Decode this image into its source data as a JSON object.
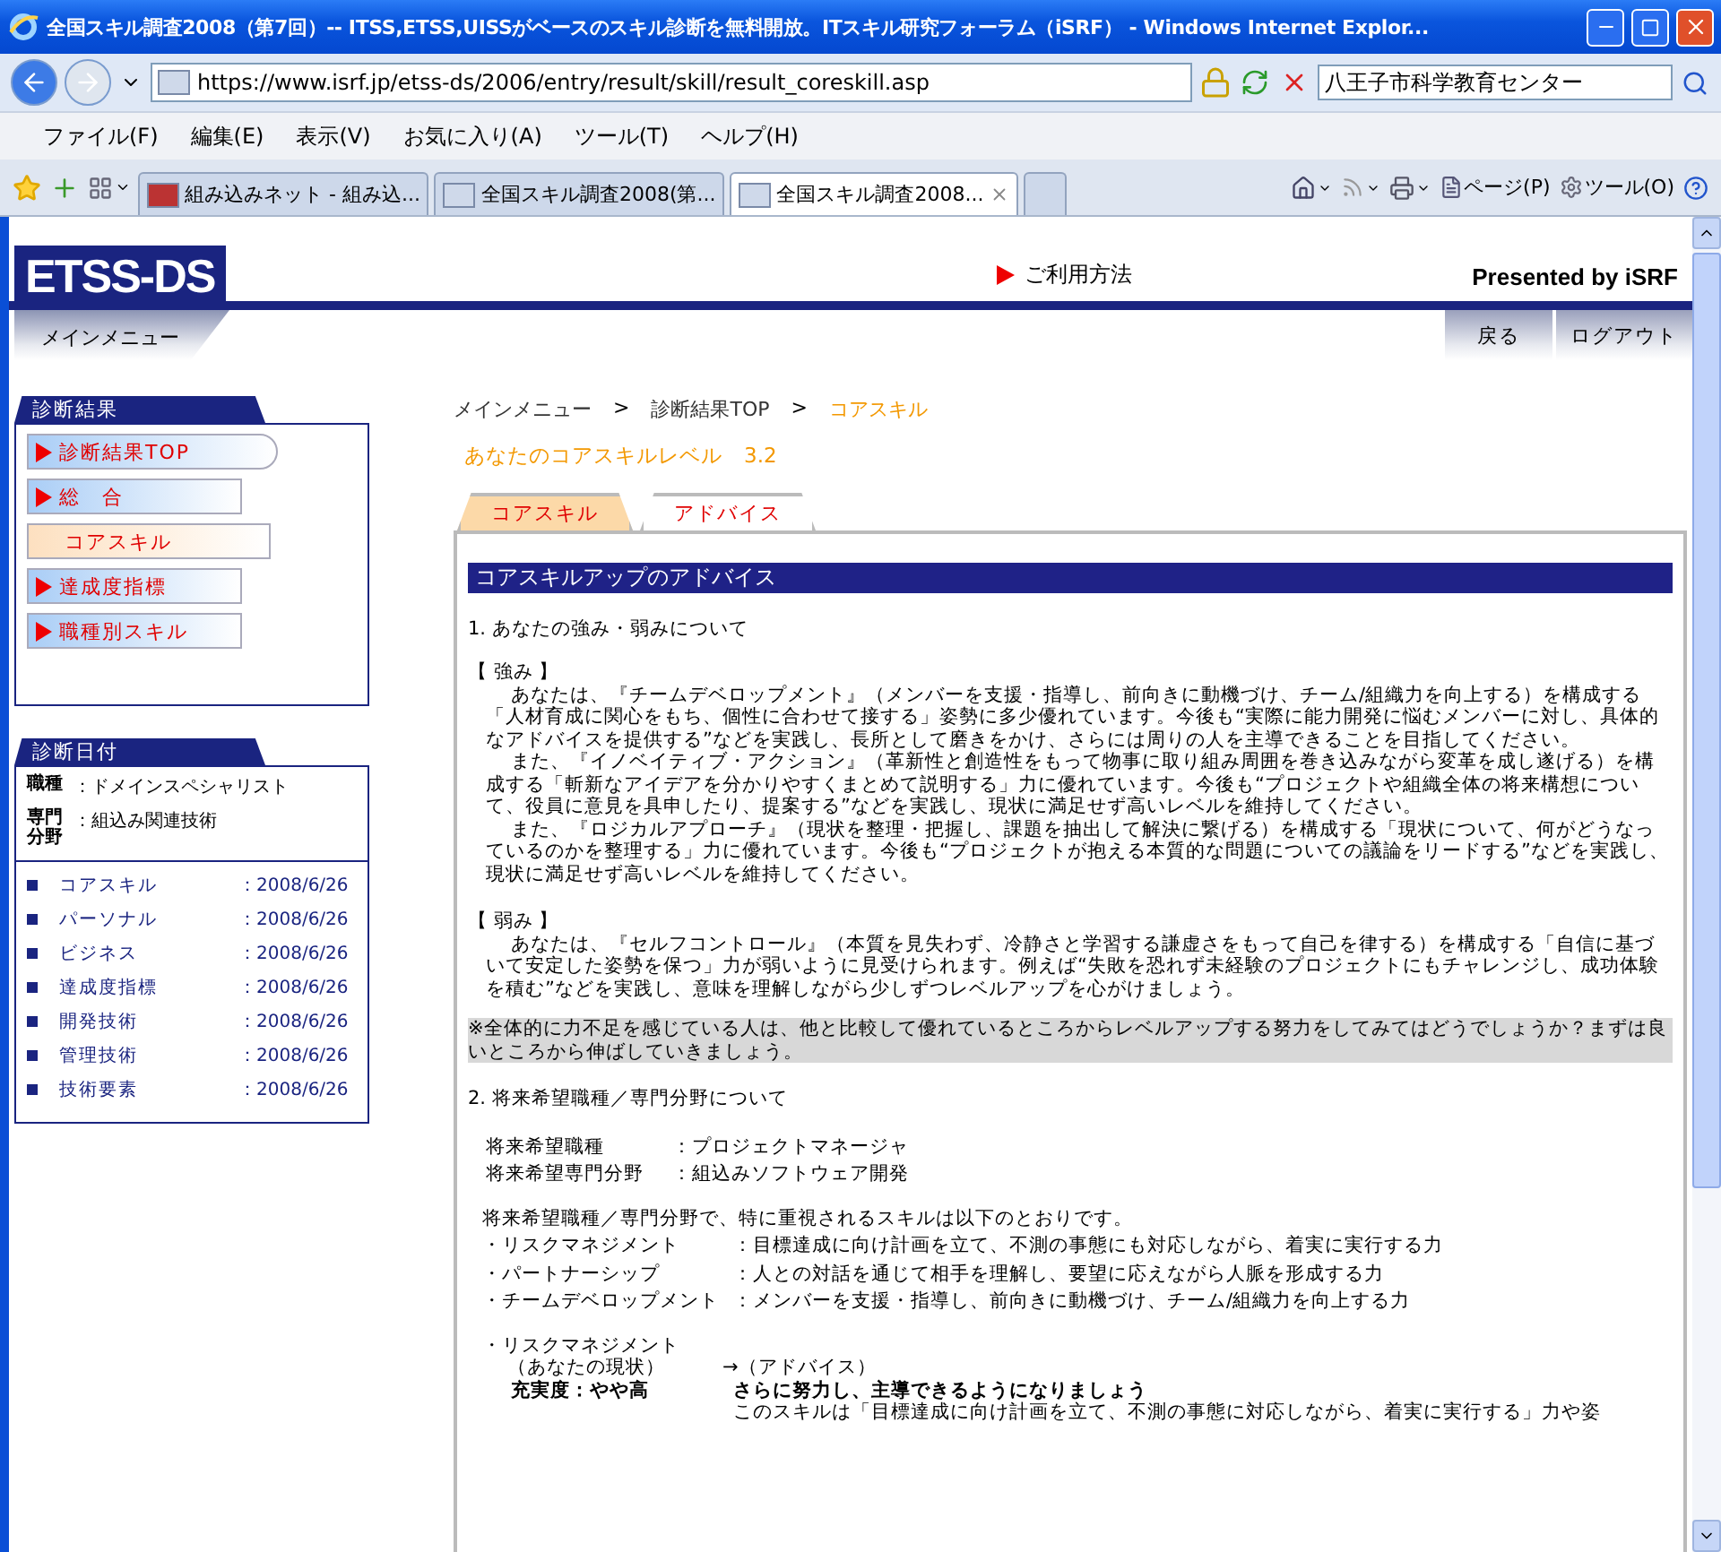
{
  "window": {
    "title": "全国スキル調査2008（第7回）-- ITSS,ETSS,UISSがベースのスキル診断を無料開放。ITスキル研究フォーラム（iSRF） - Windows Internet Explor..."
  },
  "address_bar": {
    "url": "https://www.isrf.jp/etss-ds/2006/entry/result/skill/result_coreskill.asp",
    "search_value": "八王子市科学教育センター"
  },
  "menu_bar": [
    "ファイル(F)",
    "編集(E)",
    "表示(V)",
    "お気に入り(A)",
    "ツール(T)",
    "ヘルプ(H)"
  ],
  "browser_tabs": [
    {
      "label": "組み込みネット - 組み込...",
      "selected": false,
      "kind": "site"
    },
    {
      "label": "全国スキル調査2008(第...",
      "selected": false,
      "kind": "isrf"
    },
    {
      "label": "全国スキル調査2008...",
      "selected": true,
      "kind": "isrf"
    }
  ],
  "command_bar": {
    "page": "ページ(P)",
    "tools": "ツール(O)"
  },
  "page": {
    "logo": "ETSS-DS",
    "usage_link": "ご利用方法",
    "presented_by": "Presented by iSRF",
    "main_menu": "メインメニュー",
    "nav_buttons": [
      "戻る",
      "ログアウト"
    ],
    "sidebar": {
      "results": {
        "title": "診断結果",
        "items": [
          {
            "label": "診断結果TOP",
            "selected": false,
            "kind": "round"
          },
          {
            "label": "総　合",
            "selected": false,
            "kind": "square"
          },
          {
            "label": "コアスキル",
            "selected": true,
            "kind": "square"
          },
          {
            "label": "達成度指標",
            "selected": false,
            "kind": "square"
          },
          {
            "label": "職種別スキル",
            "selected": false,
            "kind": "square"
          }
        ]
      },
      "dates": {
        "title": "診断日付",
        "profile": [
          {
            "label": "職種",
            "value": "：ドメインスペシャリスト"
          },
          {
            "label": "専門分野",
            "value": "：組込み関連技術"
          }
        ],
        "rows": [
          {
            "name": "コアスキル",
            "date": "：2008/6/26"
          },
          {
            "name": "パーソナル",
            "date": "：2008/6/26"
          },
          {
            "name": "ビジネス",
            "date": "：2008/6/26"
          },
          {
            "name": "達成度指標",
            "date": "：2008/6/26"
          },
          {
            "name": "開発技術",
            "date": "：2008/6/26"
          },
          {
            "name": "管理技術",
            "date": "：2008/6/26"
          },
          {
            "name": "技術要素",
            "date": "：2008/6/26"
          }
        ]
      }
    },
    "breadcrumb": [
      {
        "label": "メインメニュー",
        "kind": "link"
      },
      {
        "label": ">",
        "kind": "separator"
      },
      {
        "label": "診断結果TOP",
        "kind": "link"
      },
      {
        "label": ">",
        "kind": "separator"
      },
      {
        "label": "コアスキル",
        "kind": "current"
      }
    ],
    "level_text": "あなたのコアスキルレベル　3.2",
    "content_tabs": [
      {
        "label": "コアスキル",
        "selected": true
      },
      {
        "label": "アドバイス",
        "selected": false
      }
    ],
    "advice": {
      "heading": "コアスキルアップのアドバイス",
      "section_1": "1. あなたの強み・弱みについて",
      "strengths": {
        "title": "【 強み 】",
        "paragraphs": [
          "あなたは、『チームデベロップメント』（メンバーを支援・指導し、前向きに動機づけ、チーム/組織力を向上する）を構成する「人材育成に関心をもち、個性に合わせて接する」姿勢に多少優れています。今後も“実際に能力開発に悩むメンバーに対し、具体的なアドバイスを提供する”などを実践し、長所として磨きをかけ、さらには周りの人を主導できることを目指してください。",
          "また、『イノベイティブ・アクション』（革新性と創造性をもって物事に取り組み周囲を巻き込みながら変革を成し遂げる）を構成する「斬新なアイデアを分かりやすくまとめて説明する」力に優れています。今後も“プロジェクトや組織全体の将来構想について、役員に意見を具申したり、提案する”などを実践し、現状に満足せず高いレベルを維持してください。",
          "また、『ロジカルアプローチ』（現状を整理・把握し、課題を抽出して解決に繋げる）を構成する「現状について、何がどうなっているのかを整理する」力に優れています。今後も“プロジェクトが抱える本質的な問題についての議論をリードする”などを実践し、現状に満足せず高いレベルを維持してください。"
        ]
      },
      "weaknesses": {
        "title": "【 弱み 】",
        "paragraphs": [
          "あなたは、『セルフコントロール』（本質を見失わず、冷静さと学習する謙虚さをもって自己を律する）を構成する「自信に基づいて安定した姿勢を保つ」力が弱いように見受けられます。例えば“失敗を恐れず未経験のプロジェクトにもチャレンジし、成功体験を積む”などを実践し、意味を理解しながら少しずつレベルアップを心がけましょう。"
        ]
      },
      "note": "※全体的に力不足を感じている人は、他と比較して優れているところからレベルアップする努力をしてみてはどうでしょうか？まずは良いところから伸ばしていきましょう。",
      "section_2": "2. 将来希望職種／専門分野について",
      "desired": [
        {
          "label": "将来希望職種",
          "value": "：プロジェクトマネージャ"
        },
        {
          "label": "将来希望専門分野",
          "value": "：組込みソフトウェア開発"
        }
      ],
      "skills_intro": "将来希望職種／専門分野で、特に重視されるスキルは以下のとおりです。",
      "skills": [
        {
          "name": "・リスクマネジメント",
          "desc": "：目標達成に向け計画を立て、不測の事態にも対応しながら、着実に実行する力"
        },
        {
          "name": "・パートナーシップ",
          "desc": "：人との対話を通じて相手を理解し、要望に応えながら人脈を形成する力"
        },
        {
          "name": "・チームデベロップメント",
          "desc": "：メンバーを支援・指導し、前向きに動機づけ、チーム/組織力を向上する力"
        }
      ],
      "detail": {
        "name": "・リスクマネジメント",
        "current_label": "（あなたの現状）",
        "advice_label": "→（アドバイス）",
        "status": "充実度：やや高",
        "headline": "さらに努力し、主導できるようになりましょう",
        "text": "このスキルは「目標達成に向け計画を立て、不測の事態に対応しながら、着実に実行する」力や姿"
      }
    }
  }
}
